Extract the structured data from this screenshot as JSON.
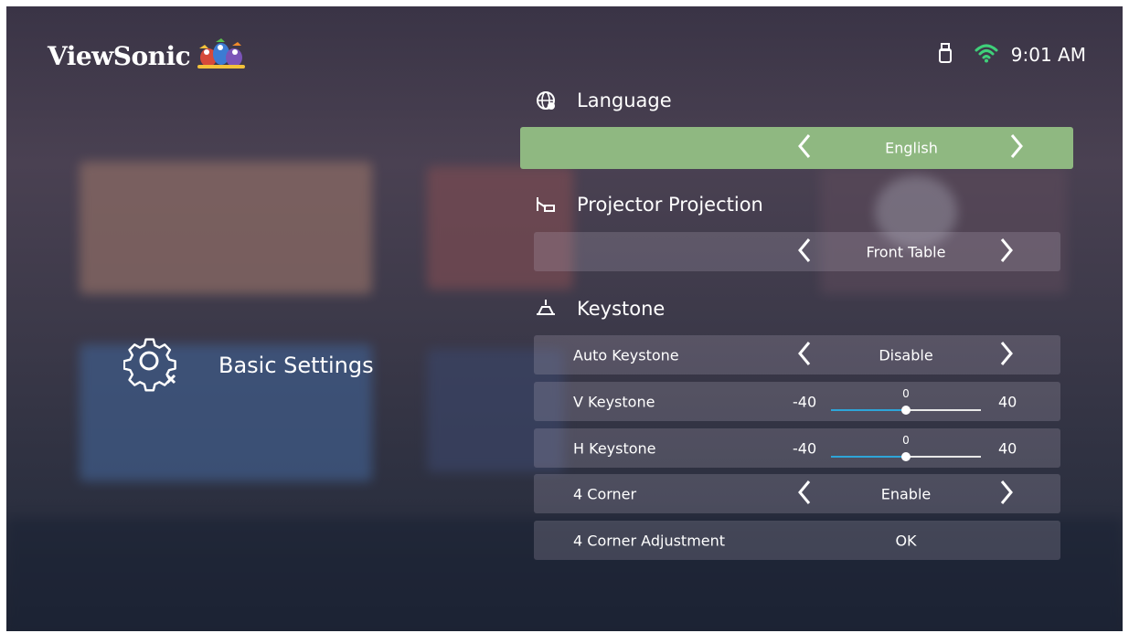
{
  "header": {
    "brand": "ViewSonic",
    "time": "9:01 AM"
  },
  "sidebar": {
    "item_label": "Basic Settings"
  },
  "sections": {
    "language": {
      "title": "Language",
      "value": "English"
    },
    "projection": {
      "title": "Projector Projection",
      "value": "Front Table"
    },
    "keystone": {
      "title": "Keystone",
      "auto_label": "Auto Keystone",
      "auto_value": "Disable",
      "v_label": "V Keystone",
      "v_min": "-40",
      "v_max": "40",
      "v_value": "0",
      "v_fraction": 0.5,
      "h_label": "H Keystone",
      "h_min": "-40",
      "h_max": "40",
      "h_value": "0",
      "h_fraction": 0.5,
      "corner_label": "4 Corner",
      "corner_value": "Enable",
      "adjust_label": "4 Corner Adjustment",
      "adjust_value": "OK"
    }
  },
  "colors": {
    "selected_row": "#8fb881",
    "wifi": "#3fd07a",
    "slider_fill": "#2ea5d8"
  },
  "icons": {
    "usb": "usb-icon",
    "wifi": "wifi-icon",
    "gear": "gear-icon",
    "globe": "globe-icon",
    "projector": "projector-icon",
    "keystone": "keystone-icon"
  }
}
